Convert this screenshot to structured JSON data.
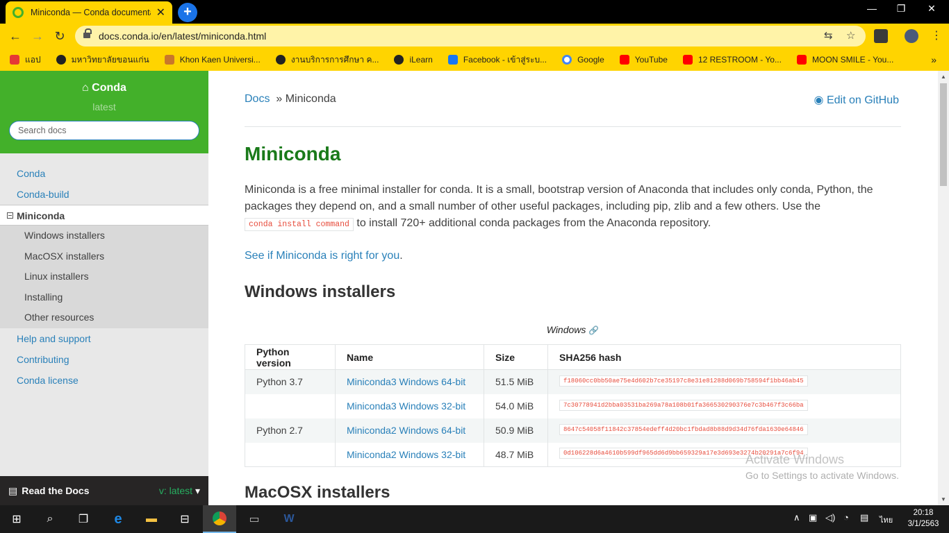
{
  "browser": {
    "tab_title": "Miniconda — Conda documenta",
    "tab_close": "✕",
    "new_tab": "+",
    "window_controls": {
      "minimize": "—",
      "maximize": "❐",
      "close": "✕"
    },
    "nav": {
      "back": "←",
      "forward": "→",
      "reload": "↻"
    },
    "url": "docs.conda.io/en/latest/miniconda.html",
    "bookmarks": [
      {
        "label": "แอป",
        "icon": "apps-grid-icon",
        "color": "#e53935"
      },
      {
        "label": "มหาวิทยาลัยขอนแก่น",
        "icon": "kku-icon",
        "color": "#222222"
      },
      {
        "label": "Khon Kaen Universi...",
        "icon": "kku-temple-icon",
        "color": "#c9772b"
      },
      {
        "label": "งานบริการการศึกษา ค...",
        "icon": "kku-icon",
        "color": "#222222"
      },
      {
        "label": "iLearn",
        "icon": "ilearn-icon",
        "color": "#222222"
      },
      {
        "label": "Facebook - เข้าสู่ระบ...",
        "icon": "facebook-icon",
        "color": "#1877f2"
      },
      {
        "label": "Google",
        "icon": "google-icon",
        "color": "#4285f4"
      },
      {
        "label": "YouTube",
        "icon": "youtube-icon",
        "color": "#ff0000"
      },
      {
        "label": "12 RESTROOM - Yo...",
        "icon": "youtube-icon",
        "color": "#ff0000"
      },
      {
        "label": "MOON SMILE - You...",
        "icon": "youtube-icon",
        "color": "#ff0000"
      }
    ],
    "bookmarks_more": "»"
  },
  "sidebar": {
    "brand": "Conda",
    "version": "latest",
    "search_placeholder": "Search docs",
    "items": [
      {
        "label": "Conda"
      },
      {
        "label": "Conda-build"
      },
      {
        "label": "Miniconda"
      },
      {
        "label": "Help and support"
      },
      {
        "label": "Contributing"
      },
      {
        "label": "Conda license"
      }
    ],
    "subitems": [
      {
        "label": "Windows installers"
      },
      {
        "label": "MacOSX installers"
      },
      {
        "label": "Linux installers"
      },
      {
        "label": "Installing"
      },
      {
        "label": "Other resources"
      }
    ],
    "rtd_label": "Read the Docs",
    "rtd_version": "v: latest"
  },
  "content": {
    "breadcrumb_docs": "Docs",
    "breadcrumb_sep": "»",
    "breadcrumb_current": "Miniconda",
    "edit_github": "Edit on GitHub",
    "title": "Miniconda",
    "intro_1": "Miniconda is a free minimal installer for conda. It is a small, bootstrap version of Anaconda that includes only conda, Python, the packages they depend on, and a small number of other useful packages, including pip, zlib and a few others. Use the",
    "intro_code": "conda install command",
    "intro_2": "to install 720+ additional conda packages from the Anaconda repository.",
    "see_if": "See if Miniconda is right for you",
    "see_if_period": ".",
    "windows_heading": "Windows installers",
    "table_caption": "Windows",
    "table_headers": [
      "Python version",
      "Name",
      "Size",
      "SHA256 hash"
    ],
    "rows": [
      {
        "python": "Python 3.7",
        "name": "Miniconda3 Windows 64-bit",
        "size": "51.5 MiB",
        "hash": "f18060cc0bb50ae75e4d602b7ce35197c8e31e81288d069b758594f1bb46ab45"
      },
      {
        "python": "",
        "name": "Miniconda3 Windows 32-bit",
        "size": "54.0 MiB",
        "hash": "7c30778941d2bba03531ba269a78a108b01fa366530290376e7c3b467f3c66ba"
      },
      {
        "python": "Python 2.7",
        "name": "Miniconda2 Windows 64-bit",
        "size": "50.9 MiB",
        "hash": "8647c54058f11842c37854edeff4d20bc1fbdad8b88d9d34d76fda1630e64846"
      },
      {
        "python": "",
        "name": "Miniconda2 Windows 32-bit",
        "size": "48.7 MiB",
        "hash": "0d106228d6a4610b599df965dd6d9bb659329a17e3d693e3274b20291a7c6f94"
      }
    ],
    "mac_heading": "MacOSX installers"
  },
  "watermark": {
    "line1": "Activate Windows",
    "line2": "Go to Settings to activate Windows."
  },
  "taskbar": {
    "time": "20:18",
    "date": "3/1/2563",
    "lang": "ไทย"
  }
}
